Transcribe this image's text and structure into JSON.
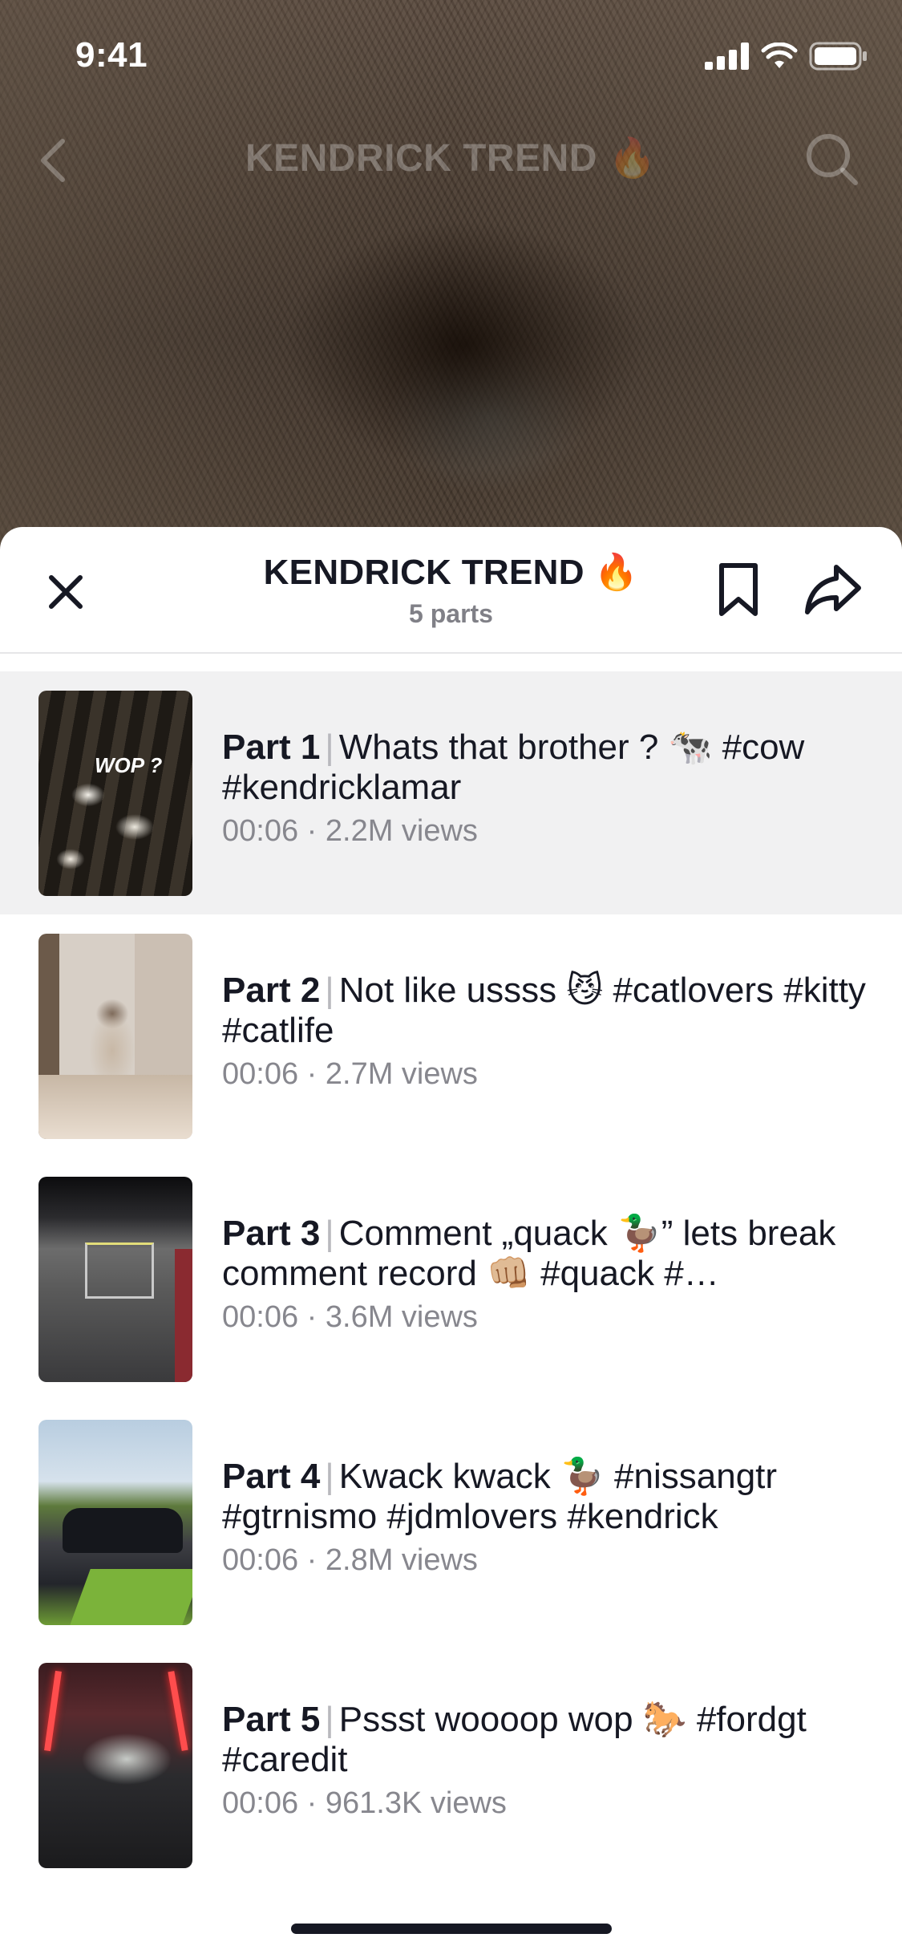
{
  "status_bar": {
    "time": "9:41"
  },
  "nav": {
    "title": "KENDRICK TREND 🔥"
  },
  "sheet": {
    "title": "KENDRICK TREND 🔥",
    "subtitle": "5 parts"
  },
  "parts": [
    {
      "label": "Part 1",
      "caption": "Whats that brother ? 🐄 #cow #kendricklamar",
      "duration": "00:06",
      "views": "2.2M views",
      "thumb_text": "WOP ?",
      "active": true
    },
    {
      "label": "Part 2",
      "caption": "Not like ussss 😼 #catlovers #kitty #catlife",
      "duration": "00:06",
      "views": "2.7M views"
    },
    {
      "label": "Part 3",
      "caption": "Comment „quack 🦆” lets break comment record 👊🏼 #quack #…",
      "duration": "00:06",
      "views": "3.6M views"
    },
    {
      "label": "Part 4",
      "caption": "Kwack kwack 🦆 #nissangtr #gtrnismo #jdmlovers #kendrick",
      "duration": "00:06",
      "views": "2.8M views"
    },
    {
      "label": "Part 5",
      "caption": "Pssst woooop wop 🐎 #fordgt #caredit",
      "duration": "00:06",
      "views": "961.3K views"
    }
  ],
  "meta_separator": " · ",
  "icons": {
    "back": "chevron-left-icon",
    "search": "search-icon",
    "close": "close-icon",
    "bookmark": "bookmark-icon",
    "share": "share-icon"
  },
  "colors": {
    "text_primary": "#161823",
    "text_secondary": "#808087",
    "active_row_bg": "#f1f1f2",
    "divider": "#e6e6e8"
  }
}
